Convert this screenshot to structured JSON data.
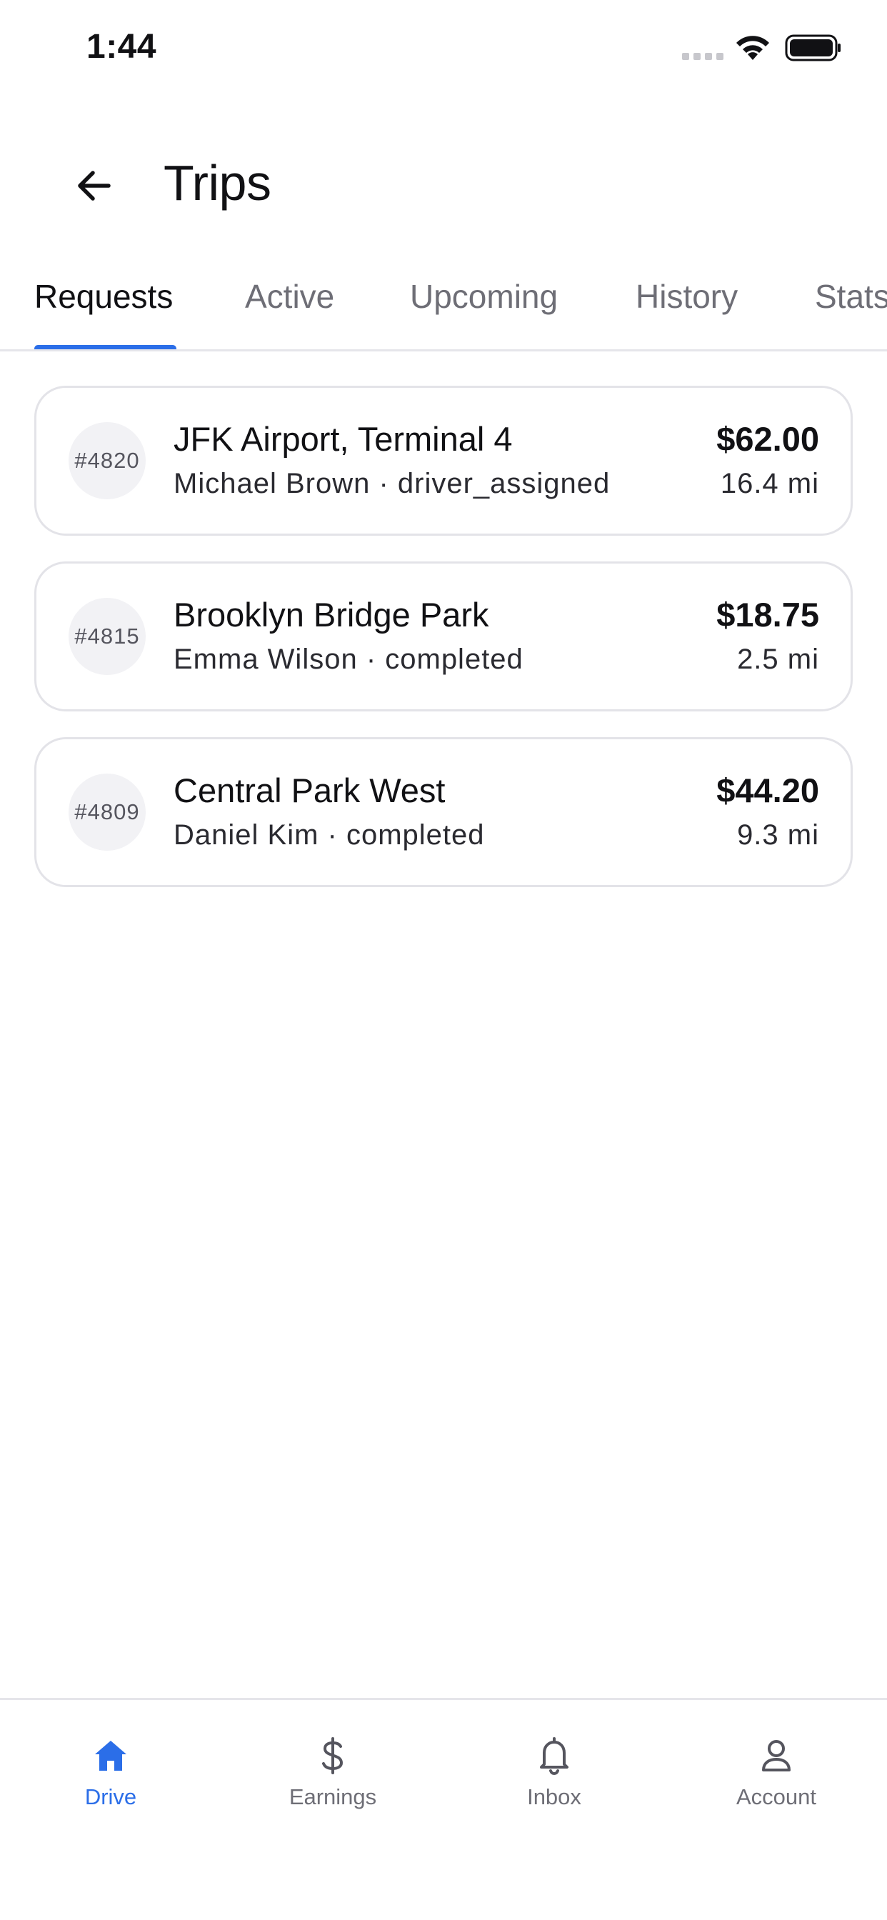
{
  "status_bar": {
    "time": "1:44"
  },
  "header": {
    "title": "Trips",
    "back_icon": "arrow-left-icon"
  },
  "tabs": [
    {
      "label": "Requests",
      "active": true
    },
    {
      "label": "Active",
      "active": false
    },
    {
      "label": "Upcoming",
      "active": false
    },
    {
      "label": "History",
      "active": false
    },
    {
      "label": "Stats",
      "active": false
    }
  ],
  "trips": [
    {
      "id": "#4820",
      "destination": "JFK Airport, Terminal 4",
      "subtitle": "Michael Brown · driver_assigned",
      "price": "$62.00",
      "distance": "16.4 mi"
    },
    {
      "id": "#4815",
      "destination": "Brooklyn Bridge Park",
      "subtitle": "Emma Wilson · completed",
      "price": "$18.75",
      "distance": "2.5 mi"
    },
    {
      "id": "#4809",
      "destination": "Central Park West",
      "subtitle": "Daniel Kim · completed",
      "price": "$44.20",
      "distance": "9.3 mi"
    }
  ],
  "bottom_nav": [
    {
      "label": "Drive",
      "icon": "home-icon",
      "active": true
    },
    {
      "label": "Earnings",
      "icon": "dollar-icon",
      "active": false
    },
    {
      "label": "Inbox",
      "icon": "bell-icon",
      "active": false
    },
    {
      "label": "Account",
      "icon": "user-icon",
      "active": false
    }
  ],
  "colors": {
    "accent": "#2b6ee8",
    "text_primary": "#111114",
    "text_secondary": "#6e6e76",
    "card_border": "#e3e3e8",
    "badge_bg": "#f2f2f5"
  }
}
